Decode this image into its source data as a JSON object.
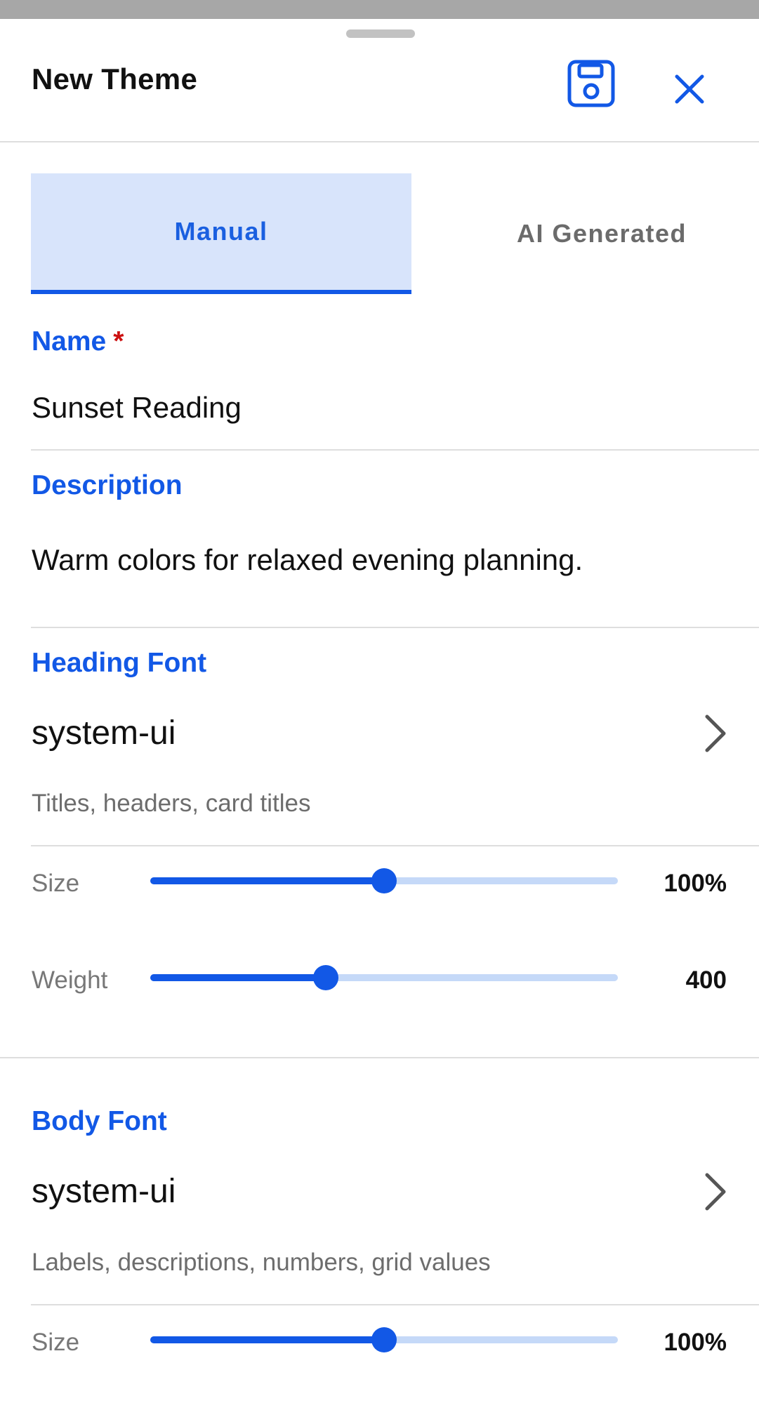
{
  "header": {
    "title": "New Theme",
    "save_icon": "save-floppy-icon",
    "close_icon": "close-x-icon"
  },
  "tabs": [
    {
      "label": "Manual",
      "selected": true
    },
    {
      "label": "AI Generated",
      "selected": false
    }
  ],
  "name_field": {
    "label": "Name",
    "required_mark": "*",
    "value": "Sunset Reading"
  },
  "description_field": {
    "label": "Description",
    "value": "Warm colors for relaxed evening planning."
  },
  "heading_font": {
    "label": "Heading Font",
    "value": "system-ui",
    "hint": "Titles, headers, card titles",
    "size": {
      "label": "Size",
      "value": "100%",
      "fraction": 0.5
    },
    "weight": {
      "label": "Weight",
      "value": "400",
      "fraction": 0.375
    }
  },
  "body_font": {
    "label": "Body Font",
    "value": "system-ui",
    "hint": "Labels, descriptions, numbers, grid values",
    "size": {
      "label": "Size",
      "value": "100%",
      "fraction": 0.5
    }
  },
  "colors": {
    "accent": "#1258E6",
    "accent_light": "#D8E4FB",
    "track": "#C5D9F8",
    "required": "#CC1111"
  }
}
